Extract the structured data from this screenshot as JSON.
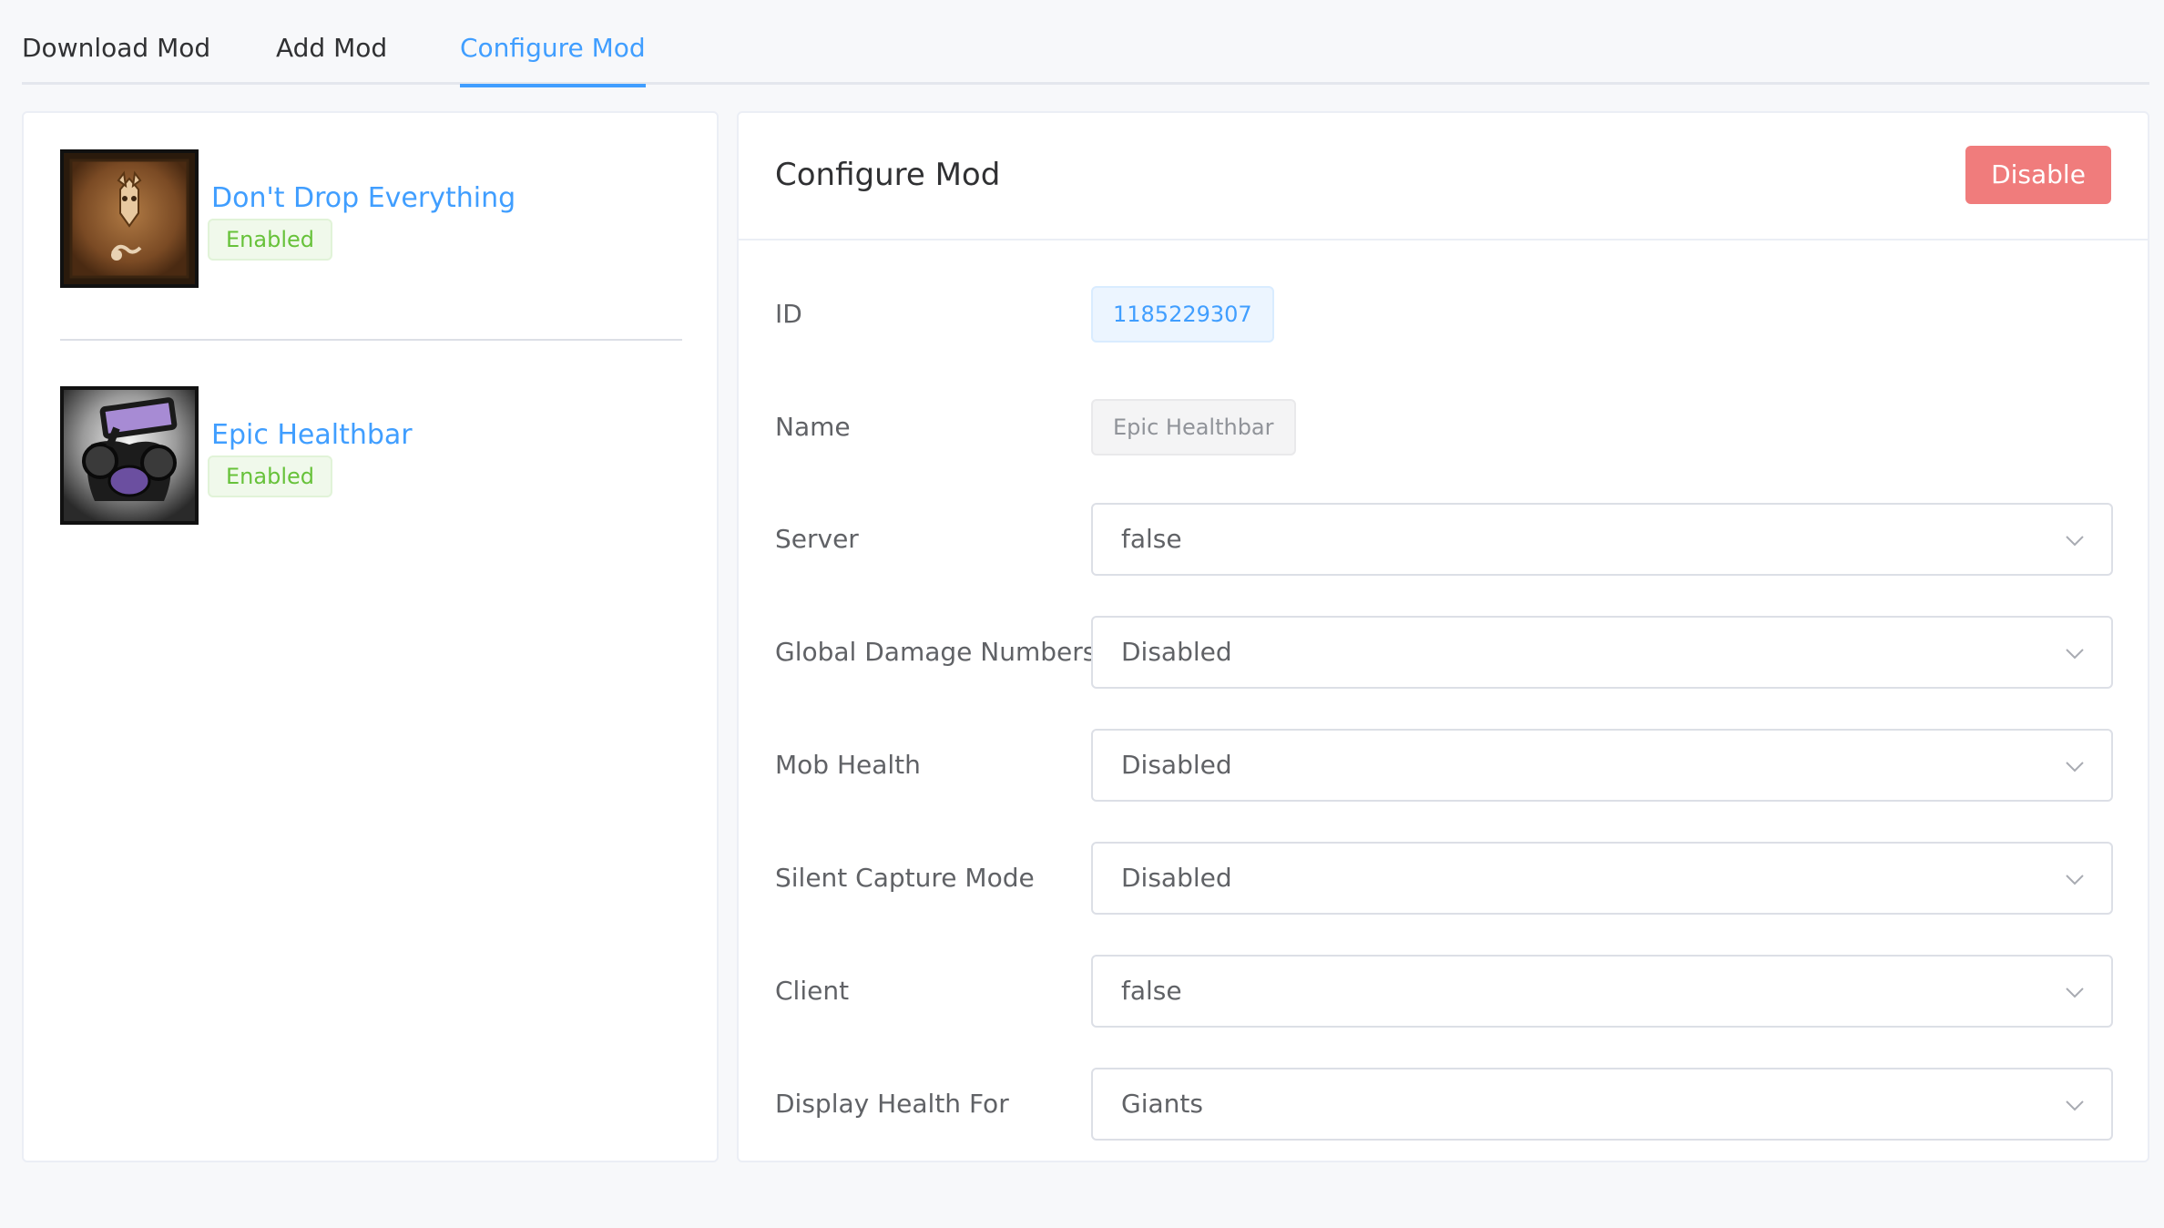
{
  "tabs": [
    {
      "label": "Download Mod",
      "active": false
    },
    {
      "label": "Add Mod",
      "active": false
    },
    {
      "label": "Configure Mod",
      "active": true
    }
  ],
  "mods": [
    {
      "name": "Don't Drop Everything",
      "status": "Enabled"
    },
    {
      "name": "Epic Healthbar",
      "status": "Enabled"
    }
  ],
  "config": {
    "title": "Configure Mod",
    "disable_label": "Disable",
    "id_label": "ID",
    "id_value": "1185229307",
    "name_label": "Name",
    "name_value": "Epic Healthbar",
    "fields": [
      {
        "label": "Server",
        "value": "false"
      },
      {
        "label": "Global Damage Numbers",
        "value": "Disabled"
      },
      {
        "label": "Mob Health",
        "value": "Disabled"
      },
      {
        "label": "Silent Capture Mode",
        "value": "Disabled"
      },
      {
        "label": "Client",
        "value": "false"
      },
      {
        "label": "Display Health For",
        "value": "Giants"
      }
    ]
  },
  "colors": {
    "accent": "#409eff",
    "success": "#67c23a",
    "danger_button": "#f07c7c",
    "page_background": "#f7f8fa"
  },
  "icons": [
    "chevron-down-icon"
  ]
}
